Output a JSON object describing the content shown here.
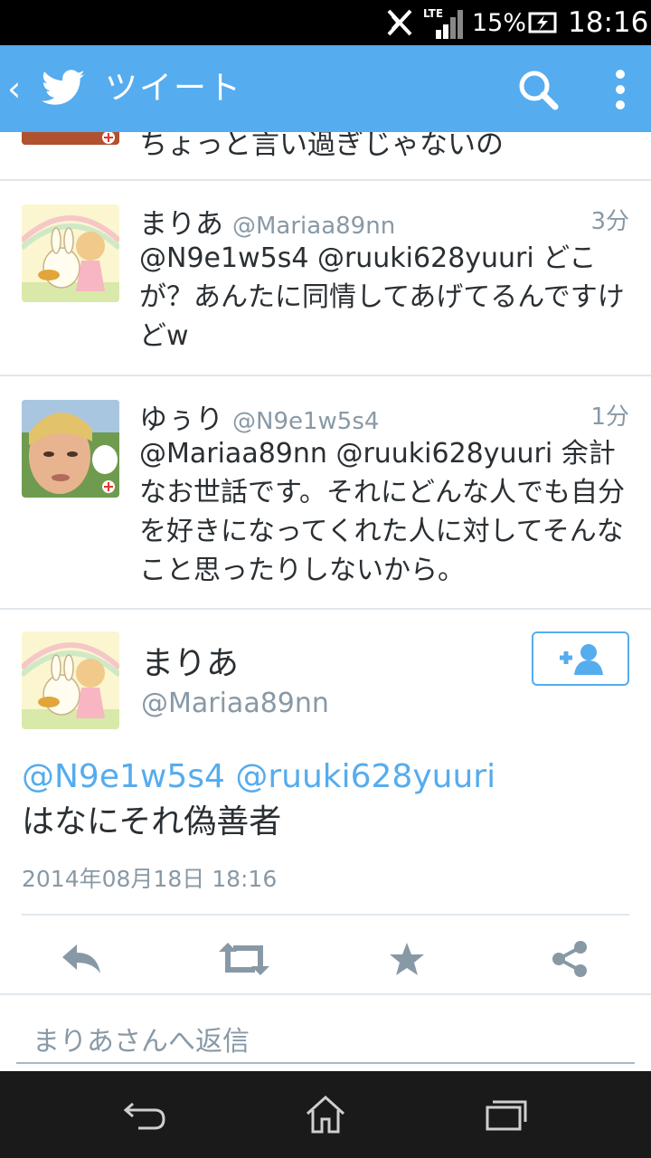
{
  "status_bar": {
    "network": "LTE",
    "battery_percent": "15%",
    "time": "18:16"
  },
  "app_bar": {
    "title": "ツイート",
    "back_icon": "chevron-left-icon",
    "logo_icon": "twitter-bird-icon",
    "search_icon": "search-icon",
    "menu_icon": "more-vertical-icon",
    "color": "#55acee"
  },
  "partial_tweet": {
    "text": "ちょっと言い過ぎじゃないの"
  },
  "tweets": [
    {
      "name": "まりあ",
      "handle": "@Mariaa89nn",
      "time": "3分",
      "text": "@N9e1w5s4 @ruuki628yuuri どこが？あんたに同情してあげてるんですけどw"
    },
    {
      "name": "ゆぅり",
      "handle": "@N9e1w5s4",
      "time": "1分",
      "text": "@Mariaa89nn @ruuki628yuuri 余計なお世話です。それにどんな人でも自分を好きになってくれた人に対してそんなこと思ったりしないから。"
    }
  ],
  "detail": {
    "name": "まりあ",
    "handle": "@Mariaa89nn",
    "mentions": "@N9e1w5s4 @ruuki628yuuri",
    "text": "はなにそれ偽善者",
    "date": "2014年08月18日 18:16",
    "follow_icon": "add-user-icon",
    "actions": [
      "reply-icon",
      "retweet-icon",
      "favorite-star-icon",
      "share-icon"
    ]
  },
  "reply": {
    "placeholder": "まりあさんへ返信"
  },
  "nav_bar": {
    "buttons": [
      "back-icon",
      "home-icon",
      "recent-apps-icon"
    ]
  }
}
